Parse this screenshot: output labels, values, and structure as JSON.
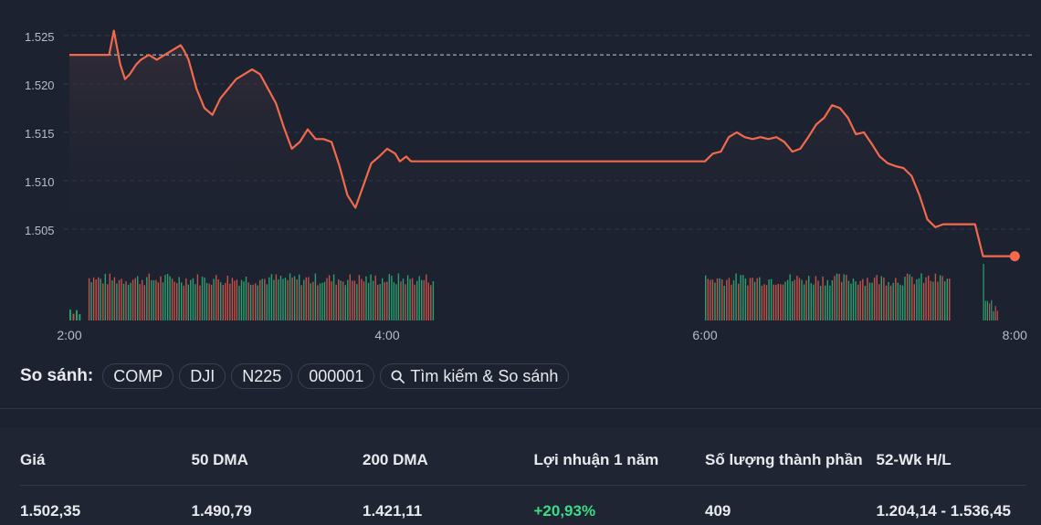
{
  "chart_data": {
    "type": "line",
    "y_ticks": [
      "1.525",
      "1.520",
      "1.515",
      "1.510",
      "1.505"
    ],
    "y_tick_values": [
      1.525,
      1.52,
      1.515,
      1.51,
      1.505
    ],
    "ylim": [
      1.5015,
      1.5265
    ],
    "x_ticks": [
      "2:00",
      "4:00",
      "6:00",
      "8:00"
    ],
    "x_tick_values": [
      2.0,
      4.0,
      6.0,
      7.95
    ],
    "xlim": [
      2.0,
      8.0
    ],
    "previous_close": 1.523,
    "line_color": "#f26a4b",
    "up_color": "#2fb67a",
    "down_color": "#e05c4e",
    "series": [
      {
        "x": [
          2.0,
          2.1,
          2.2,
          2.25,
          2.28,
          2.32,
          2.35,
          2.38,
          2.42,
          2.45,
          2.5,
          2.55,
          2.6,
          2.65,
          2.7,
          2.72,
          2.75,
          2.8,
          2.85,
          2.9,
          2.95,
          3.0,
          3.05,
          3.1,
          3.15,
          3.2,
          3.25,
          3.3,
          3.35,
          3.4,
          3.45,
          3.5,
          3.55,
          3.6,
          3.65,
          3.7,
          3.75,
          3.8,
          3.85,
          3.9,
          3.95,
          4.0,
          4.05,
          4.08,
          4.12,
          4.15,
          4.2,
          4.25,
          4.3,
          4.35,
          4.4,
          4.5,
          4.6,
          5.0,
          5.5,
          6.0,
          6.05,
          6.1,
          6.15,
          6.2,
          6.25,
          6.3,
          6.35,
          6.4,
          6.45,
          6.5,
          6.55,
          6.6,
          6.65,
          6.7,
          6.75,
          6.8,
          6.85,
          6.9,
          6.95,
          7.0,
          7.05,
          7.1,
          7.15,
          7.2,
          7.25,
          7.3,
          7.35,
          7.4,
          7.45,
          7.5,
          7.6,
          7.7,
          7.75,
          7.95
        ],
        "y": [
          1.523,
          1.523,
          1.523,
          1.523,
          1.5255,
          1.522,
          1.5205,
          1.521,
          1.522,
          1.5225,
          1.523,
          1.5225,
          1.523,
          1.5235,
          1.524,
          1.5235,
          1.5225,
          1.5195,
          1.5175,
          1.5168,
          1.5185,
          1.5195,
          1.5205,
          1.521,
          1.5215,
          1.521,
          1.5195,
          1.518,
          1.5155,
          1.5133,
          1.514,
          1.5153,
          1.5143,
          1.5143,
          1.514,
          1.5115,
          1.5085,
          1.5072,
          1.5095,
          1.5118,
          1.5125,
          1.5133,
          1.5128,
          1.512,
          1.5125,
          1.512,
          1.512,
          1.512,
          1.512,
          1.512,
          1.512,
          1.512,
          1.512,
          1.512,
          1.512,
          1.512,
          1.5128,
          1.513,
          1.5145,
          1.515,
          1.5145,
          1.5143,
          1.5145,
          1.5143,
          1.5145,
          1.514,
          1.513,
          1.5133,
          1.5145,
          1.5158,
          1.5165,
          1.5178,
          1.5175,
          1.5165,
          1.5148,
          1.515,
          1.5138,
          1.5125,
          1.5118,
          1.5115,
          1.5113,
          1.5105,
          1.5085,
          1.506,
          1.5052,
          1.5055,
          1.5055,
          1.5055,
          1.5022,
          1.5022
        ]
      }
    ],
    "volume_segments": [
      {
        "start": 2.0,
        "end": 2.08,
        "count": 4
      },
      {
        "start": 2.12,
        "end": 4.3,
        "count": 150
      },
      {
        "start": 6.0,
        "end": 7.55,
        "count": 105
      },
      {
        "start": 7.75,
        "end": 7.85,
        "count": 8
      }
    ]
  },
  "compare": {
    "label": "So sánh:",
    "chips": [
      "COMP",
      "DJI",
      "N225",
      "000001"
    ],
    "search_label": "Tìm kiếm & So sánh"
  },
  "stats": {
    "headers": [
      "Giá",
      "50 DMA",
      "200 DMA",
      "Lợi nhuận 1 năm",
      "Số lượng thành phần",
      "52-Wk H/L"
    ],
    "values": [
      "1.502,35",
      "1.490,79",
      "1.421,11",
      "+20,93%",
      "409",
      "1.204,14 - 1.536,45"
    ]
  }
}
